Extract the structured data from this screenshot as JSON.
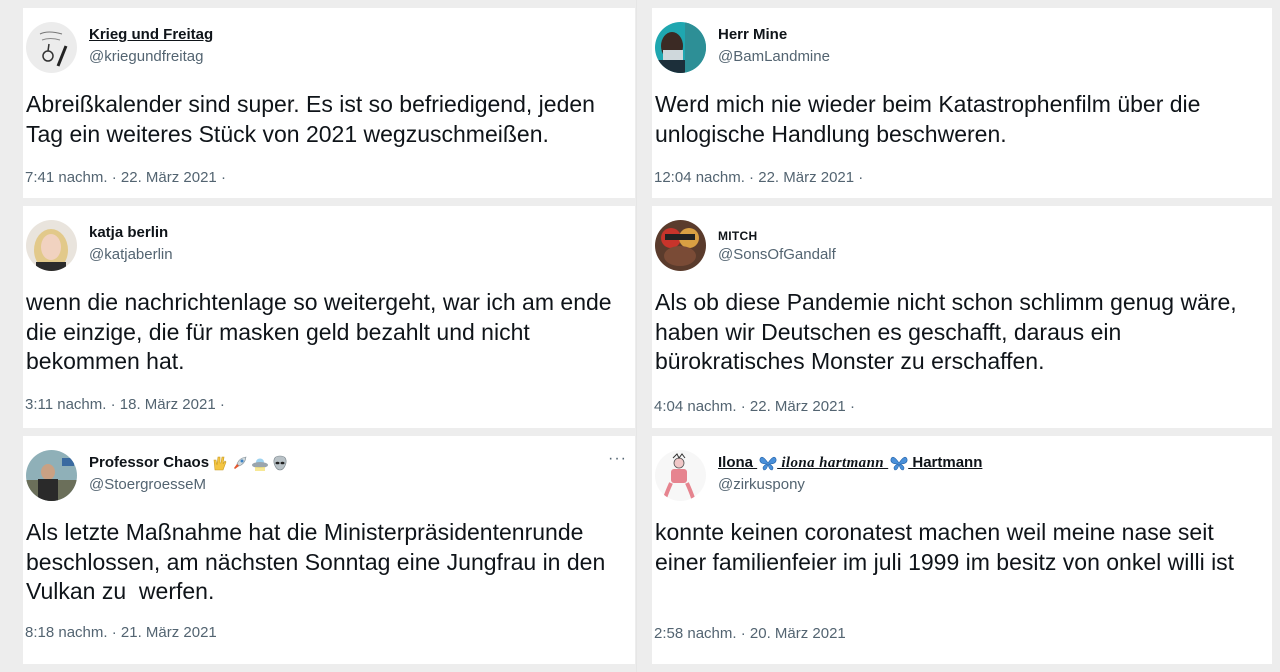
{
  "tweets": [
    {
      "name": "Krieg und Freitag",
      "handle": "@kriegundfreitag",
      "text": "Abreißkalender sind super. Es ist so befriedigend, jeden Tag ein weiteres Stück von 2021 wegzuschmeißen.",
      "meta": "7:41 nachm. · 22. März 2021 ·",
      "avatar_icon": "sketch-avatar-icon"
    },
    {
      "name": "Herr Mine",
      "handle": "@BamLandmine",
      "text": "Werd mich nie wieder beim Katastrophenfilm über die unlogische Handlung beschweren.",
      "meta": "12:04 nachm. · 22. März 2021 ·",
      "avatar_icon": "teal-photo-avatar-icon"
    },
    {
      "name": "katja berlin",
      "handle": "@katjaberlin",
      "text": "wenn die nachrichtenlage so weitergeht, war ich am ende die einzige, die für masken geld bezahlt und nicht bekommen hat.",
      "meta": "3:11 nachm. · 18. März 2021 ·",
      "avatar_icon": "portrait-avatar-icon"
    },
    {
      "name": "MITCH",
      "handle": "@SonsOfGandalf",
      "text": "Als ob diese Pandemie nicht schon schlimm genug wäre, haben wir Deutschen es geschafft, daraus ein bürokratisches Monster zu erschaffen.",
      "meta": "4:04 nachm. · 22. März 2021 ·",
      "avatar_icon": "red-photo-avatar-icon"
    },
    {
      "name": "Professor Chaos",
      "name_emojis": [
        "vulcan-salute-icon",
        "rocket-icon",
        "ufo-icon",
        "alien-icon"
      ],
      "handle": "@StoergroesseM",
      "text": "Als letzte Maßnahme hat die Ministerpräsidentenrunde beschlossen, am nächsten Sonntag eine Jungfrau in den Vulkan zu  werfen.",
      "meta": "8:18 nachm. · 21. März 2021",
      "more": "···",
      "avatar_icon": "photo-avatar-icon"
    },
    {
      "name_part1": "Ilona ",
      "name_part2": " ilona hartmann ",
      "name_part3": " Hartmann",
      "name_emojis": [
        "butterfly-icon",
        "butterfly-icon"
      ],
      "handle": "@zirkuspony",
      "text": "konnte keinen coronatest machen weil meine nase seit einer familienfeier im juli 1999 im besitz von onkel willi ist",
      "meta": "2:58 nachm. · 20. März 2021",
      "avatar_icon": "drawing-avatar-icon"
    }
  ]
}
